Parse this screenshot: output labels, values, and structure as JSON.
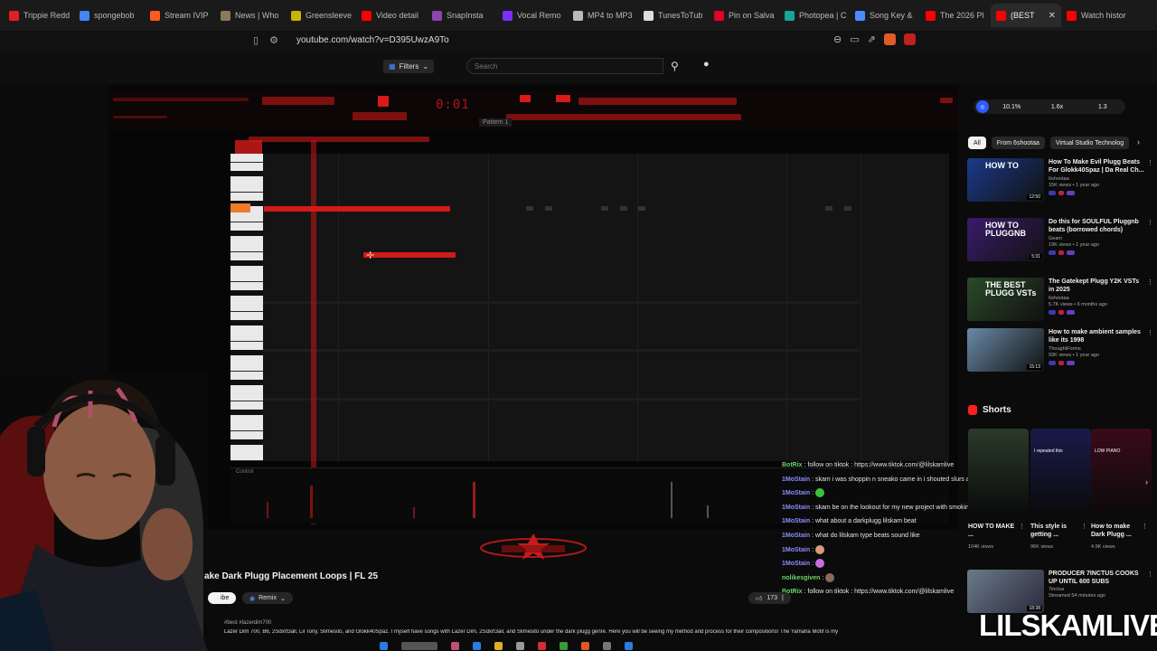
{
  "browser": {
    "tabs": [
      {
        "label": "Trippie Redd",
        "color": "#e02020"
      },
      {
        "label": "spongebob",
        "color": "#4285f4"
      },
      {
        "label": "Stream IVIP",
        "color": "#ff5a1f"
      },
      {
        "label": "News | Who",
        "color": "#8a7a5a"
      },
      {
        "label": "Greensleeve",
        "color": "#c8b400"
      },
      {
        "label": "Video detail",
        "color": "#ff0000"
      },
      {
        "label": "SnapInsta",
        "color": "#8e44ad"
      },
      {
        "label": "Vocal Remo",
        "color": "#7b2fff"
      },
      {
        "label": "MP4 to MP3",
        "color": "#bbbbbb"
      },
      {
        "label": "TunesToTub",
        "color": "#dddddd"
      },
      {
        "label": "Pin on Salva",
        "color": "#e60023"
      },
      {
        "label": "Photopea | C",
        "color": "#18a497"
      },
      {
        "label": "Song Key &",
        "color": "#4a8cff"
      },
      {
        "label": "The 2026 Pl",
        "color": "#ff0000"
      },
      {
        "label": "(BEST",
        "color": "#ff0000",
        "active": true
      },
      {
        "label": "Watch histor",
        "color": "#ff0000"
      }
    ],
    "url": "youtube.com/watch?v=D395UwzA9To"
  },
  "header": {
    "filters_label": "Filters",
    "search_placeholder": "Search"
  },
  "daw": {
    "time_readout": "0:01",
    "pattern_label": "Pattern 1",
    "control_label": "Control"
  },
  "chat": [
    {
      "user": "BotRix",
      "user_style": "green",
      "text": " : follow on tiktok : https://www.tiktok.com/@lilskamlive"
    },
    {
      "user": "1MoStain",
      "text": " : skam i was shoppin n sneako came in i shouted slurs at him"
    },
    {
      "user": "1MoStain",
      "text": " : ",
      "emote": "#3cc13c"
    },
    {
      "user": "1MoStain",
      "text": " : skam be on the lookout for my new project with smokinskul ok"
    },
    {
      "user": "1MoStain",
      "text": " : what about a darkplugg lilskam beat"
    },
    {
      "user": "1MoStain",
      "text": " : what do lilskam type beats sound like"
    },
    {
      "user": "1MoStain",
      "text": " : ",
      "emote": "#d99a7a"
    },
    {
      "user": "1MoStain",
      "text": " : ",
      "emote": "#c66de0"
    },
    {
      "user": "nolikesgiven",
      "user_style": "green",
      "text": " : ",
      "emote": "#8a6a5a"
    },
    {
      "user": "BotRix",
      "user_style": "green",
      "text": " : follow on tiktok : https://www.tiktok.com/@lilskamlive"
    }
  ],
  "video": {
    "title": "ake Dark Plugg Placement Loops | FL 25",
    "subscribe_label": "ibe",
    "remix_label": "Remix",
    "likes": "173",
    "hashtags": "#best #lazerdim700",
    "description": "Lazer Dim 700, B6, 2Sdxrt3all, Lil Tony, Slimesito, and Glokk40Spaz. I myself have songs with Lazer Dim, 2Sdxrt3all, and Slimesito under the dark plugg genre. Here you will be seeing my method and process for their compositions! The Yamaha Motif is my"
  },
  "sidebar": {
    "extension_values": [
      "10.1%",
      "1.6x",
      "1.3"
    ],
    "chips": [
      {
        "label": "All",
        "active": true
      },
      {
        "label": "From 6shootaa",
        "active": false
      },
      {
        "label": "Virtual Studio Technolog",
        "active": false
      }
    ],
    "recommendations": [
      {
        "title": "How To Make Evil Plugg Beats For Glokk40Spaz | Da Real Ch...",
        "channel": "6shootaa",
        "stats": "15K views • 1 year ago",
        "duration": "12:50",
        "thumb_text": "HOW TO",
        "thumb_color": "#1b3a8a"
      },
      {
        "title": "Do this for SOULFUL Pluggnb beats (borrowed chords)",
        "channel": "Geam",
        "stats": "19K views • 1 year ago",
        "duration": "5:31",
        "thumb_text": "HOW TO PLUGGNB",
        "thumb_color": "#3a1b6a"
      },
      {
        "title": "The Gatekept Plugg Y2K VSTs in 2025",
        "channel": "6shootaa",
        "stats": "5.7K views • 6 months ago",
        "duration": "",
        "thumb_text": "THE BEST PLUGG VSTs",
        "thumb_color": "#2a4a2a"
      },
      {
        "title": "How to make ambient samples like its 1998",
        "channel": "ThoughtForms",
        "stats": "93K views • 1 year ago",
        "duration": "15:13",
        "thumb_text": "",
        "thumb_color": "#6a8aa8"
      }
    ],
    "shorts_label": "Shorts",
    "shorts": [
      {
        "title": "HOW TO MAKE ...",
        "views": "104K views",
        "color": "#2a3a2a",
        "overlay": ""
      },
      {
        "title": "This style is getting ...",
        "views": "96K views",
        "color": "#1a1a4a",
        "overlay": "I repeated this"
      },
      {
        "title": "How to make Dark Plugg ...",
        "views": "4.9K views",
        "color": "#3a0a1a",
        "overlay": "LOW PIANO"
      }
    ],
    "bottom_rec": {
      "title": "PRODUCER 7INCTUS COOKS UP UNTIL 600 SUBS",
      "channel": "7inctus",
      "stats": "Streamed 54 minutes ago",
      "duration": "18:38"
    },
    "watermark": "LILSKAMLIVE"
  }
}
